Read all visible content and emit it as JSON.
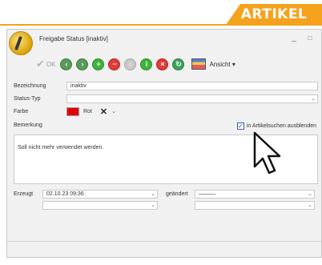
{
  "banner": {
    "label": "ARTIKEL"
  },
  "window": {
    "title": "Freigabe Status [inaktiv]",
    "minimize_glyph": "_",
    "maximize_glyph": "□"
  },
  "toolbar": {
    "ok_label": "OK",
    "buttons": [
      "nav-back-icon",
      "nav-forward-icon",
      "add-icon",
      "remove-icon",
      "refresh-icon",
      "info-icon",
      "delete-icon",
      "confirm-icon"
    ],
    "view_label": "Ansicht ▾"
  },
  "form": {
    "bezeichnung_label": "Bezeichnung",
    "bezeichnung_value": "inaktiv",
    "statustyp_label": "Status-Typ",
    "statustyp_value": "",
    "farbe_label": "Farbe",
    "farbe_value": "Rot",
    "farbe_color": "#e10000",
    "bemerkung_label": "Bemerkung",
    "checkbox_label": "in Artikelsuchen ausblenden",
    "checkbox_checked": true,
    "bemerkung_text": "Soll nicht mehr verwendet werden.",
    "erzeugt_label": "Erzeugt",
    "erzeugt_value": "02.10.23 09:36",
    "geaendert_label": "geändert",
    "geaendert_value": "———"
  },
  "colors": {
    "accent": "#f5a21c",
    "window_bg": "#f1f1f1"
  }
}
